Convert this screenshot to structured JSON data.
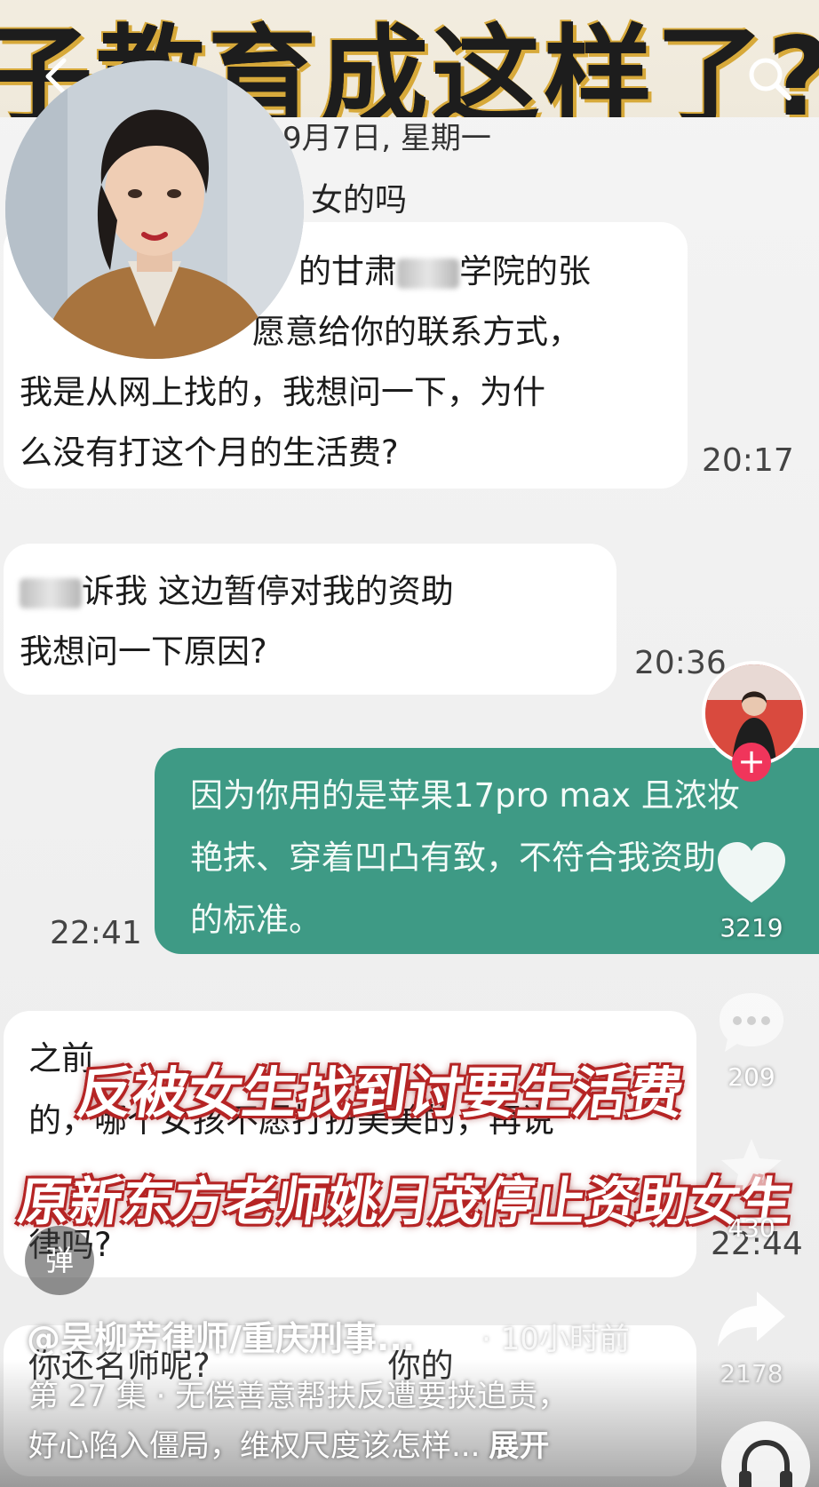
{
  "banner": {
    "title": "子教育成这样了?"
  },
  "chat": {
    "date": "9月7日, 星期一",
    "greeting": "女的吗",
    "msg1": {
      "line1": "的甘肃",
      "line1b": "学院的张",
      "line2": "愿意给你的联系方式，",
      "line3": "我是从网上找的，我想问一下，为什",
      "line4": "么没有打这个月的生活费?",
      "time": "20:17"
    },
    "msg2": {
      "line1": "诉我 这边暂停对我的资助",
      "line2": "我想问一下原因?",
      "time": "20:36"
    },
    "msg3": {
      "line1": "因为你用的是苹果17pro max 且浓妆",
      "line2": "艳抹、穿着凹凸有致，不符合我资助",
      "line3": "的标准。",
      "time": "22:41"
    },
    "msg4": {
      "line1": "之前",
      "line2": "的，哪个女孩不愿打扮美美的，再说",
      "line4": "律吗?",
      "time": "22:44"
    },
    "msg5": {
      "line1": "你还名师呢?",
      "line1b": "你的"
    }
  },
  "captions": {
    "caption1": "反被女生找到讨要生活费",
    "caption2": "原新东方老师姚月茂停止资助女生"
  },
  "rail": {
    "likes": "3219",
    "comments": "209",
    "favorites": "430",
    "shares": "2178",
    "follow_label": "+"
  },
  "danmu_label": "弹",
  "video": {
    "author": "@吴柳芳律师/重庆刑事...",
    "posted": "· 10小时前",
    "desc_line1": "第 27 集 · 无偿善意帮扶反遭要挟追责，",
    "desc_line2": "好心陷入僵局，维权尺度该怎样...",
    "expand_label": "展开"
  }
}
